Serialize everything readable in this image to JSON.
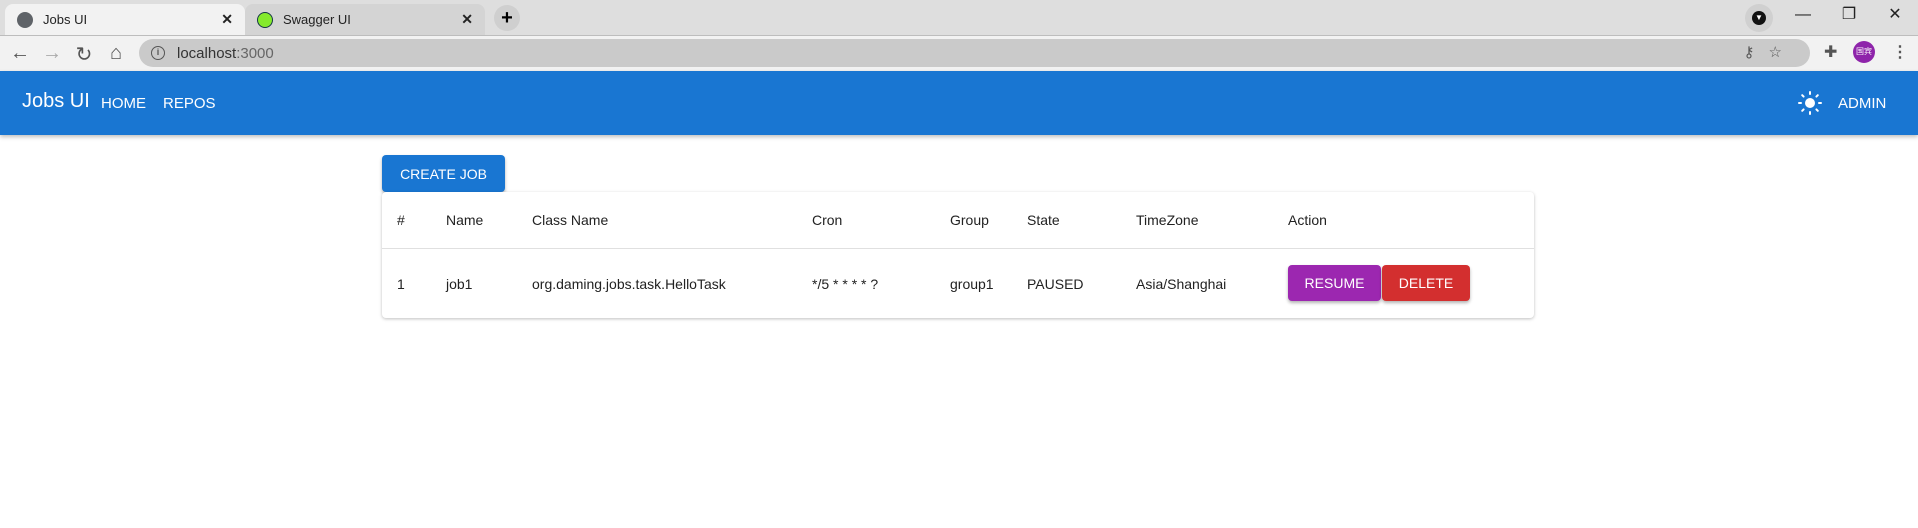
{
  "browser": {
    "tabs": [
      {
        "label": "Jobs UI",
        "icon": "globe-icon",
        "active": true
      },
      {
        "label": "Swagger UI",
        "icon": "swagger-icon",
        "active": false
      }
    ],
    "url": {
      "host": "localhost",
      "port": ":3000"
    },
    "avatar_text": "国宾"
  },
  "appbar": {
    "title": "Jobs UI",
    "nav": [
      "HOME",
      "REPOS"
    ],
    "user": "ADMIN",
    "theme_icon": "sun-icon",
    "color": "#1976d2"
  },
  "main": {
    "create_label": "CREATE JOB",
    "columns": [
      "#",
      "Name",
      "Class Name",
      "Cron",
      "Group",
      "State",
      "TimeZone",
      "Action"
    ],
    "rows": [
      {
        "id": "1",
        "name": "job1",
        "class_name": "org.daming.jobs.task.HelloTask",
        "cron": "*/5 * * * * ?",
        "group": "group1",
        "state": "PAUSED",
        "timezone": "Asia/Shanghai",
        "actions": [
          "RESUME",
          "DELETE"
        ]
      }
    ],
    "colors": {
      "resume": "#9c27b0",
      "delete": "#d32f2f"
    }
  }
}
